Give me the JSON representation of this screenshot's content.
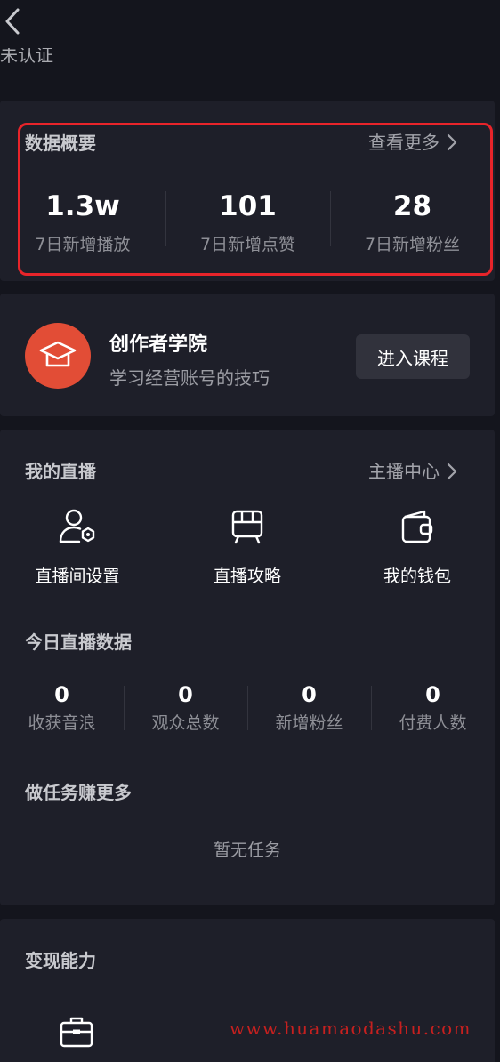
{
  "header": {
    "cert_label": "未认证"
  },
  "overview": {
    "title": "数据概要",
    "more_label": "查看更多",
    "stats": [
      {
        "value": "1.3w",
        "label": "7日新增播放"
      },
      {
        "value": "101",
        "label": "7日新增点赞"
      },
      {
        "value": "28",
        "label": "7日新增粉丝"
      }
    ]
  },
  "academy": {
    "title": "创作者学院",
    "subtitle": "学习经营账号的技巧",
    "button_label": "进入课程"
  },
  "live": {
    "title": "我的直播",
    "more_label": "主播中心",
    "tools": [
      {
        "label": "直播间设置",
        "icon": "user-settings-icon"
      },
      {
        "label": "直播攻略",
        "icon": "guide-icon"
      },
      {
        "label": "我的钱包",
        "icon": "wallet-icon"
      }
    ],
    "today_title": "今日直播数据",
    "today_stats": [
      {
        "value": "0",
        "label": "收获音浪"
      },
      {
        "value": "0",
        "label": "观众总数"
      },
      {
        "value": "0",
        "label": "新增粉丝"
      },
      {
        "value": "0",
        "label": "付费人数"
      }
    ],
    "task_title": "做任务赚更多",
    "task_empty": "暂无任务"
  },
  "monetize": {
    "title": "变现能力",
    "icon": "briefcase-icon"
  },
  "watermark": "www.huamaodashu.com",
  "colors": {
    "background": "#14151d",
    "card": "#1e1f29",
    "highlight": "#e8242a",
    "academy_accent": "#e24d36",
    "watermark": "#c6201f"
  }
}
